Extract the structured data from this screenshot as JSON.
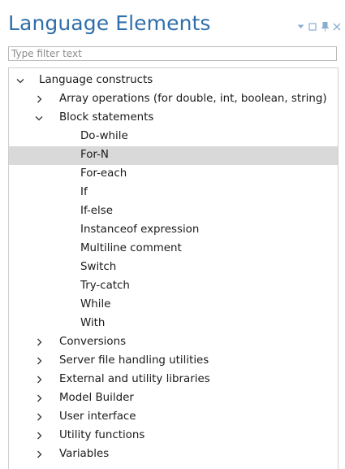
{
  "panel": {
    "title": "Language Elements",
    "filter_placeholder": "Type filter text"
  },
  "icons": {
    "dropdown": "chevron-down-icon",
    "restore": "restore-icon",
    "pin": "pin-icon",
    "close": "close-icon"
  },
  "tree": {
    "root": {
      "label": "Language constructs",
      "expanded": true
    },
    "array_ops": {
      "label": "Array operations (for double, int, boolean, string)",
      "expanded": false
    },
    "block": {
      "label": "Block statements",
      "expanded": true,
      "items": [
        {
          "label": "Do-while"
        },
        {
          "label": "For-N",
          "selected": true
        },
        {
          "label": "For-each"
        },
        {
          "label": "If"
        },
        {
          "label": "If-else"
        },
        {
          "label": "Instanceof expression"
        },
        {
          "label": "Multiline comment"
        },
        {
          "label": "Switch"
        },
        {
          "label": "Try-catch"
        },
        {
          "label": "While"
        },
        {
          "label": "With"
        }
      ]
    },
    "others": [
      {
        "label": "Conversions"
      },
      {
        "label": "Server file handling utilities"
      },
      {
        "label": "External and utility libraries"
      },
      {
        "label": "Model Builder"
      },
      {
        "label": "User interface"
      },
      {
        "label": "Utility functions"
      },
      {
        "label": "Variables"
      }
    ]
  },
  "colors": {
    "title": "#2f6fab",
    "selection": "#d9d9d9",
    "window_controls": "#8aaed0"
  }
}
